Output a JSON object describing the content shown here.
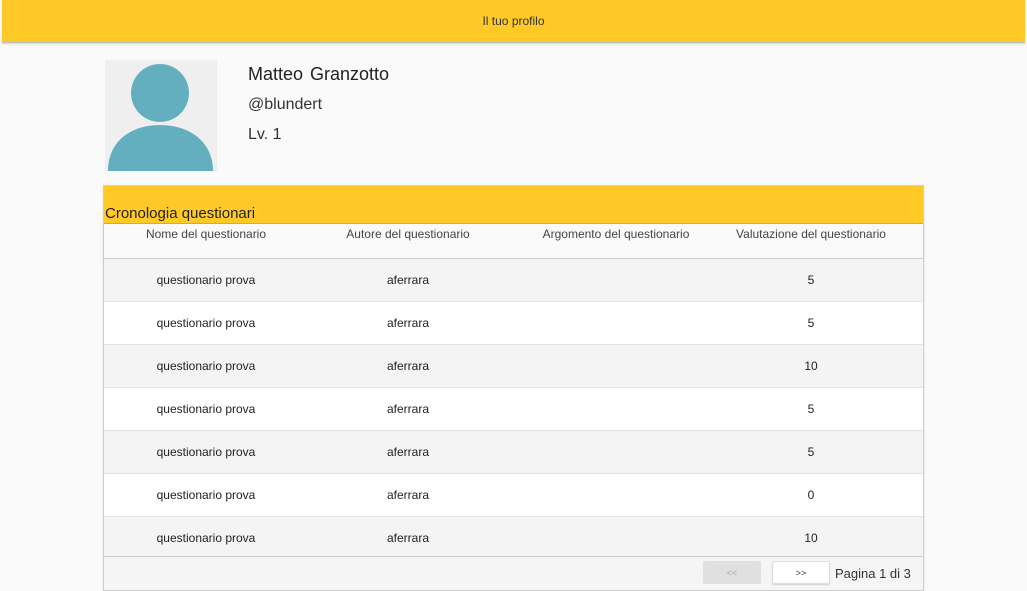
{
  "header": {
    "title": "Il tuo profilo"
  },
  "profile": {
    "name": "Matteo  Granzotto",
    "handle": "@blundert",
    "level": "Lv. 1"
  },
  "history": {
    "title": "Cronologia questionari",
    "columns": [
      "Nome del questionario",
      "Autore del questionario",
      "Argomento del questionario",
      "Valutazione del questionario"
    ],
    "rows": [
      {
        "name": "questionario prova",
        "author": "aferrara",
        "topic": "",
        "rating": "5"
      },
      {
        "name": "questionario prova",
        "author": "aferrara",
        "topic": "",
        "rating": "5"
      },
      {
        "name": "questionario prova",
        "author": "aferrara",
        "topic": "",
        "rating": "10"
      },
      {
        "name": "questionario prova",
        "author": "aferrara",
        "topic": "",
        "rating": "5"
      },
      {
        "name": "questionario prova",
        "author": "aferrara",
        "topic": "",
        "rating": "5"
      },
      {
        "name": "questionario prova",
        "author": "aferrara",
        "topic": "",
        "rating": "0"
      },
      {
        "name": "questionario prova",
        "author": "aferrara",
        "topic": "",
        "rating": "10"
      }
    ],
    "pagination": {
      "prev_label": "<<",
      "next_label": ">>",
      "info": "Pagina 1 di 3"
    }
  },
  "colors": {
    "accent": "#ffca28",
    "avatar": "#64afbf"
  },
  "icons": {
    "avatar": "user-silhouette-icon"
  }
}
